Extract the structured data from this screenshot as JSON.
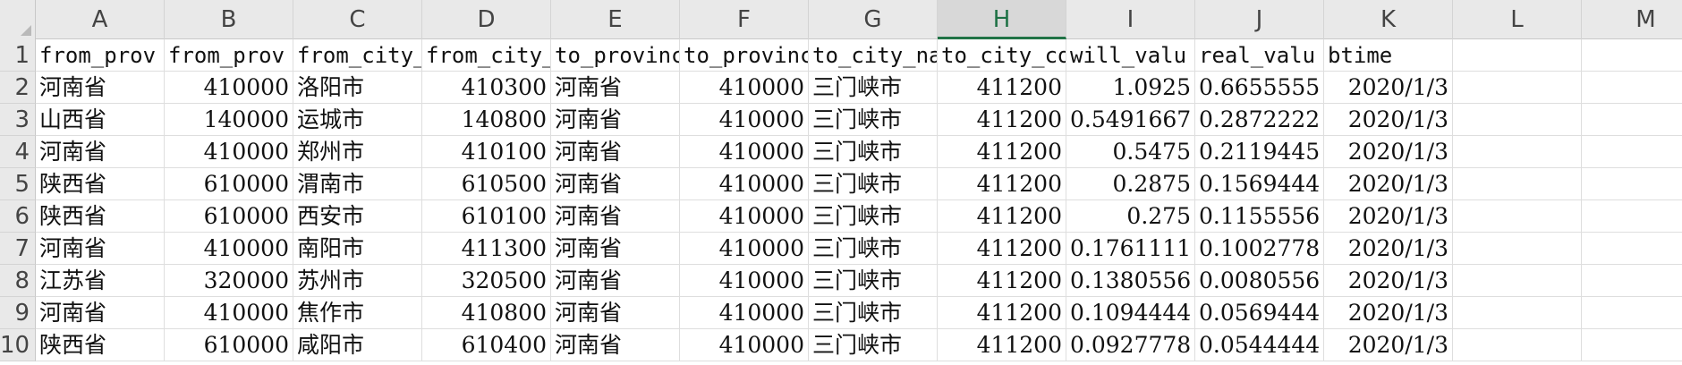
{
  "sheet": {
    "columns": [
      "A",
      "B",
      "C",
      "D",
      "E",
      "F",
      "G",
      "H",
      "I",
      "J",
      "K",
      "L",
      "M"
    ],
    "selected_column": "H",
    "row_numbers": [
      "1",
      "2",
      "3",
      "4",
      "5",
      "6",
      "7",
      "8",
      "9",
      "10"
    ],
    "header_cells": [
      "from_prov",
      "from_prov",
      "from_city_",
      "from_city_",
      "to_provinc",
      "to_provinc",
      "to_city_na",
      "to_city_co",
      "will_valu",
      "real_valu",
      "btime"
    ],
    "rows": [
      [
        "河南省",
        "410000",
        "洛阳市",
        "410300",
        "河南省",
        "410000",
        "三门峡市",
        "411200",
        "1.0925",
        "0.6655555",
        "2020/1/3"
      ],
      [
        "山西省",
        "140000",
        "运城市",
        "140800",
        "河南省",
        "410000",
        "三门峡市",
        "411200",
        "0.5491667",
        "0.2872222",
        "2020/1/3"
      ],
      [
        "河南省",
        "410000",
        "郑州市",
        "410100",
        "河南省",
        "410000",
        "三门峡市",
        "411200",
        "0.5475",
        "0.2119445",
        "2020/1/3"
      ],
      [
        "陕西省",
        "610000",
        "渭南市",
        "610500",
        "河南省",
        "410000",
        "三门峡市",
        "411200",
        "0.2875",
        "0.1569444",
        "2020/1/3"
      ],
      [
        "陕西省",
        "610000",
        "西安市",
        "610100",
        "河南省",
        "410000",
        "三门峡市",
        "411200",
        "0.275",
        "0.1155556",
        "2020/1/3"
      ],
      [
        "河南省",
        "410000",
        "南阳市",
        "411300",
        "河南省",
        "410000",
        "三门峡市",
        "411200",
        "0.1761111",
        "0.1002778",
        "2020/1/3"
      ],
      [
        "江苏省",
        "320000",
        "苏州市",
        "320500",
        "河南省",
        "410000",
        "三门峡市",
        "411200",
        "0.1380556",
        "0.0080556",
        "2020/1/3"
      ],
      [
        "河南省",
        "410000",
        "焦作市",
        "410800",
        "河南省",
        "410000",
        "三门峡市",
        "411200",
        "0.1094444",
        "0.0569444",
        "2020/1/3"
      ],
      [
        "陕西省",
        "610000",
        "咸阳市",
        "610400",
        "河南省",
        "410000",
        "三门峡市",
        "411200",
        "0.0927778",
        "0.0544444",
        "2020/1/3"
      ]
    ],
    "colors": {
      "header_bg": "#e9e9e9",
      "grid": "#dedede",
      "selected_accent": "#217346"
    }
  }
}
